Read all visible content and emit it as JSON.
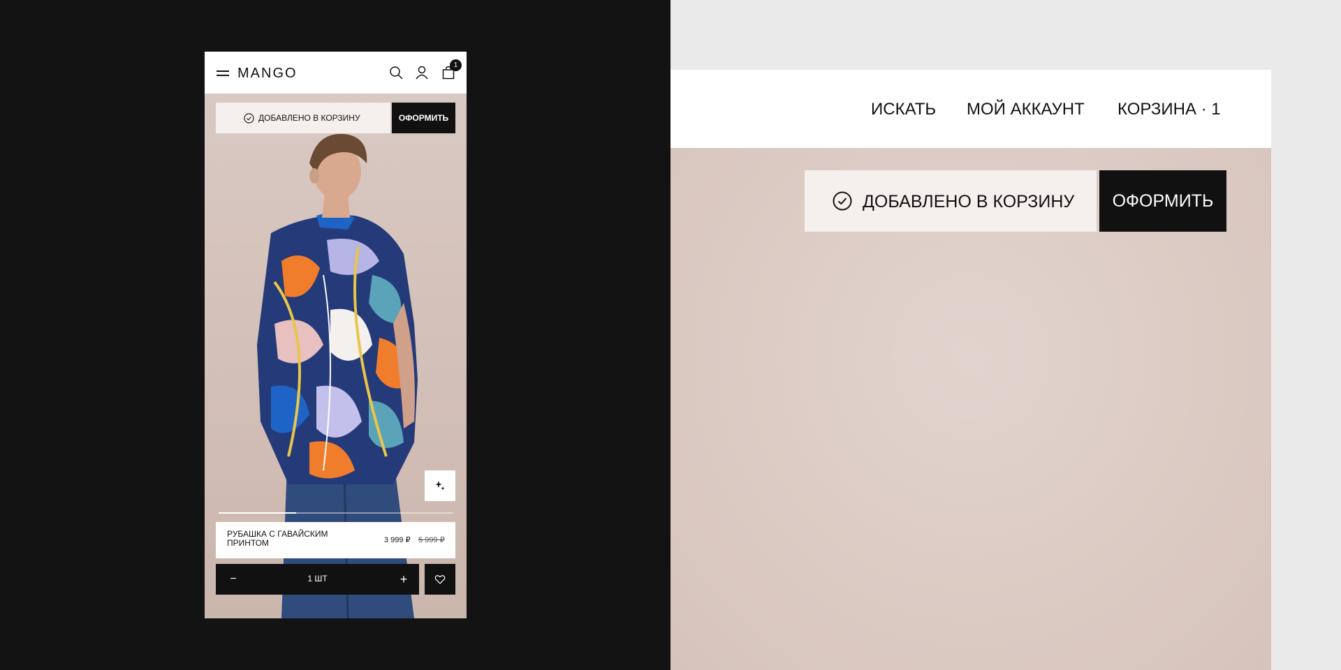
{
  "phone": {
    "brand": "MANGO",
    "header_icons": [
      "menu-icon",
      "search-icon",
      "user-icon",
      "bag-icon"
    ],
    "cart_count": "1",
    "added_message": "ДОБАВЛЕНО В КОРЗИНУ",
    "checkout_label": "ОФОРМИТЬ",
    "product": {
      "name": "РУБАШКА С ГАВАЙСКИМ ПРИНТОМ",
      "price": "3 999 ₽",
      "old_price": "5 999 ₽"
    },
    "gallery_progress": 0.33,
    "quantity": {
      "minus": "−",
      "label": "1 ШТ",
      "plus": "+"
    }
  },
  "zoom": {
    "nav": {
      "search": "ИСКАТЬ",
      "account": "МОЙ АККАУНТ",
      "cart": "КОРЗИНА · 1"
    },
    "added_message": "ДОБАВЛЕНО В КОРЗИНУ",
    "checkout_label": "ОФОРМИТЬ"
  },
  "colors": {
    "dark_bg": "#131313",
    "light_bg": "#eaeaea",
    "accent_black": "#111111",
    "toast_bg": "#f5f0ed",
    "photo_bg": "#d9c6bf"
  }
}
